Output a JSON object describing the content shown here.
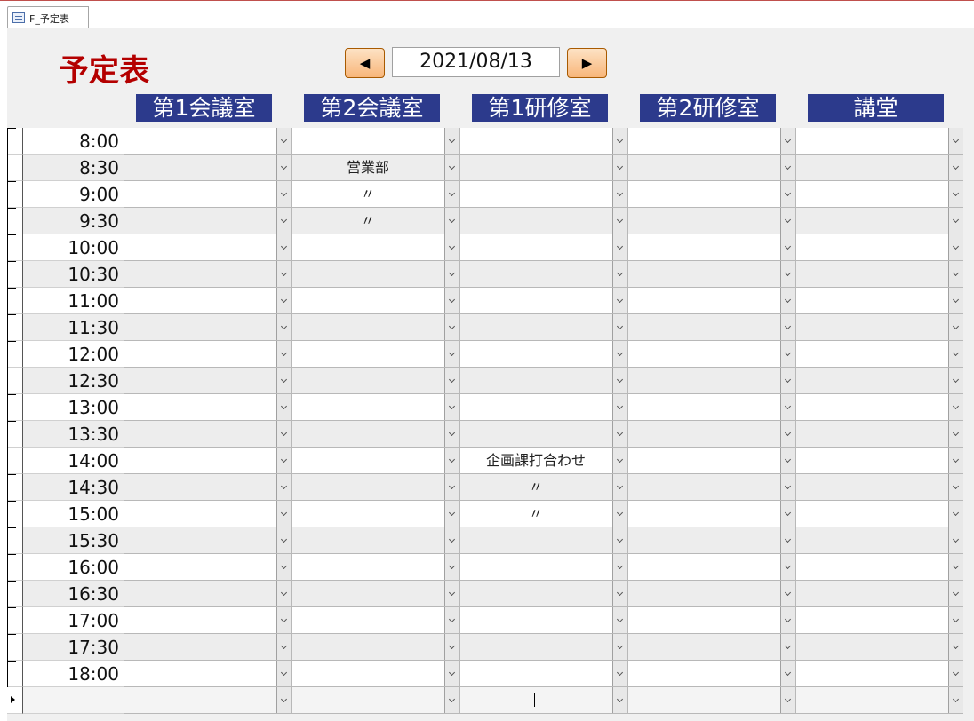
{
  "tab": {
    "label": "F_予定表",
    "icon": "form-icon"
  },
  "form_title": "予定表",
  "nav": {
    "prev_label": "◀",
    "next_label": "▶",
    "date": "2021/08/13"
  },
  "rooms": [
    "第1会議室",
    "第2会議室",
    "第1研修室",
    "第2研修室",
    "講堂"
  ],
  "rows": [
    {
      "time": "8:00",
      "cells": [
        "",
        "",
        "",
        "",
        ""
      ]
    },
    {
      "time": "8:30",
      "cells": [
        "",
        "営業部",
        "",
        "",
        ""
      ]
    },
    {
      "time": "9:00",
      "cells": [
        "",
        "〃",
        "",
        "",
        ""
      ]
    },
    {
      "time": "9:30",
      "cells": [
        "",
        "〃",
        "",
        "",
        ""
      ]
    },
    {
      "time": "10:00",
      "cells": [
        "",
        "",
        "",
        "",
        ""
      ]
    },
    {
      "time": "10:30",
      "cells": [
        "",
        "",
        "",
        "",
        ""
      ]
    },
    {
      "time": "11:00",
      "cells": [
        "",
        "",
        "",
        "",
        ""
      ]
    },
    {
      "time": "11:30",
      "cells": [
        "",
        "",
        "",
        "",
        ""
      ]
    },
    {
      "time": "12:00",
      "cells": [
        "",
        "",
        "",
        "",
        ""
      ]
    },
    {
      "time": "12:30",
      "cells": [
        "",
        "",
        "",
        "",
        ""
      ]
    },
    {
      "time": "13:00",
      "cells": [
        "",
        "",
        "",
        "",
        ""
      ]
    },
    {
      "time": "13:30",
      "cells": [
        "",
        "",
        "",
        "",
        ""
      ]
    },
    {
      "time": "14:00",
      "cells": [
        "",
        "",
        "企画課打合わせ",
        "",
        ""
      ]
    },
    {
      "time": "14:30",
      "cells": [
        "",
        "",
        "〃",
        "",
        ""
      ]
    },
    {
      "time": "15:00",
      "cells": [
        "",
        "",
        "〃",
        "",
        ""
      ]
    },
    {
      "time": "15:30",
      "cells": [
        "",
        "",
        "",
        "",
        ""
      ]
    },
    {
      "time": "16:00",
      "cells": [
        "",
        "",
        "",
        "",
        ""
      ]
    },
    {
      "time": "16:30",
      "cells": [
        "",
        "",
        "",
        "",
        ""
      ]
    },
    {
      "time": "17:00",
      "cells": [
        "",
        "",
        "",
        "",
        ""
      ]
    },
    {
      "time": "17:30",
      "cells": [
        "",
        "",
        "",
        "",
        ""
      ]
    },
    {
      "time": "18:00",
      "cells": [
        "",
        "",
        "",
        "",
        ""
      ]
    }
  ],
  "new_record": {
    "time": "",
    "cells": [
      "",
      "",
      "",
      "",
      ""
    ]
  }
}
